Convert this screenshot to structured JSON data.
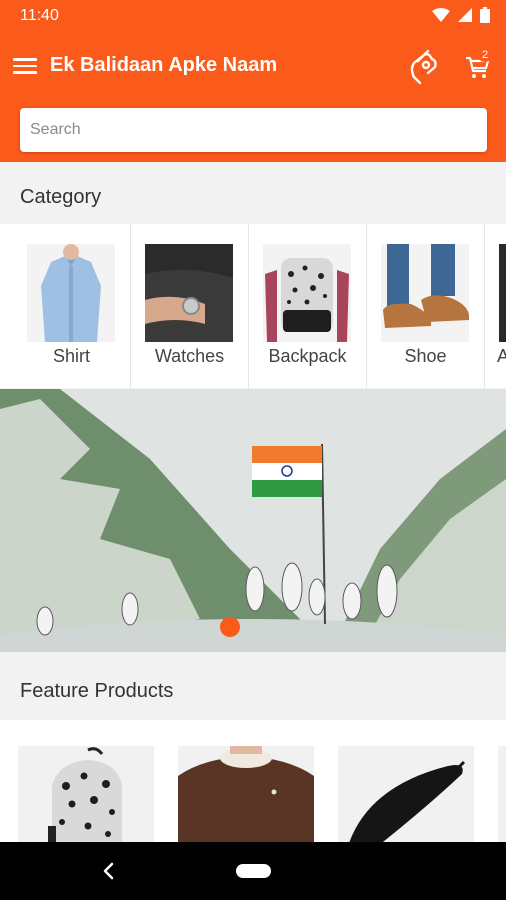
{
  "status": {
    "time": "11:40"
  },
  "header": {
    "title": "Ek Balidaan Apke Naam",
    "cart_count": "2",
    "accent_color": "#fa5a1a"
  },
  "search": {
    "placeholder": "Search"
  },
  "category": {
    "title": "Category",
    "items": [
      {
        "label": "Shirt",
        "icon": "shirt-image"
      },
      {
        "label": "Watches",
        "icon": "watch-image"
      },
      {
        "label": "Backpack",
        "icon": "backpack-image"
      },
      {
        "label": "Shoe",
        "icon": "shoe-image"
      },
      {
        "label": "A",
        "icon": "partial-category-image"
      }
    ]
  },
  "banner": {
    "image": "soldiers-flag-mountain-banner",
    "active_slide": 1
  },
  "features": {
    "title": "Feature Products",
    "items": [
      {
        "icon": "backpack-product-image"
      },
      {
        "icon": "sweater-product-image"
      },
      {
        "icon": "umbrella-product-image"
      }
    ]
  }
}
